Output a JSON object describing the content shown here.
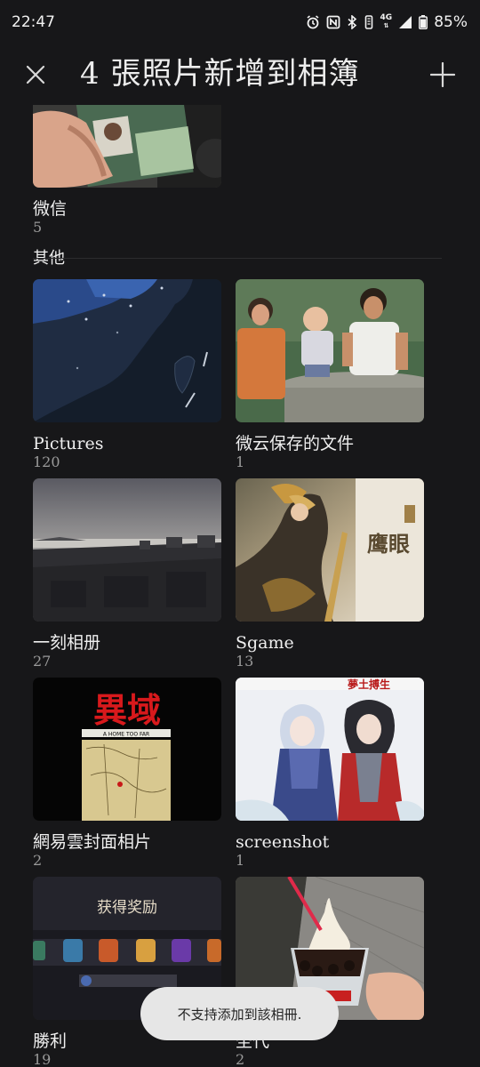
{
  "status": {
    "time": "22:47",
    "battery": "85%",
    "net": "4G"
  },
  "header": {
    "title": "4 張照片新增到相簿"
  },
  "partial_album": {
    "name": "微信",
    "count": "5"
  },
  "section": {
    "label": "其他"
  },
  "albums": [
    {
      "name": "Pictures",
      "count": "120"
    },
    {
      "name": "微云保存的文件",
      "count": "1"
    },
    {
      "name": "一刻相册",
      "count": "27"
    },
    {
      "name": "Sgame",
      "count": "13"
    },
    {
      "name": "網易雲封面相片",
      "count": "2"
    },
    {
      "name": "screenshot",
      "count": "1"
    },
    {
      "name": "勝利",
      "count": "19"
    },
    {
      "name": "圣代",
      "count": "2"
    }
  ],
  "thumb_text": {
    "sgame_banner": "鹰眼",
    "game_title": "異域",
    "game_subtitle": "A HOME TOO FAR",
    "anime_banner": "夢土搏生",
    "reward_title": "获得奖励"
  },
  "toast": {
    "message": "不支持添加到該相冊."
  },
  "colors": {
    "background": "#171719",
    "toast_bg": "#e6e6e6",
    "text": "#ececec",
    "subtext": "#9a9a9a"
  }
}
